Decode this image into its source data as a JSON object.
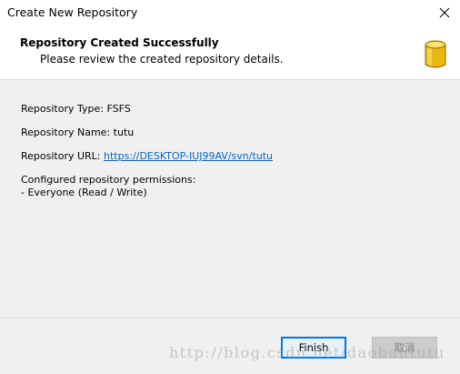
{
  "window": {
    "title": "Create New Repository"
  },
  "header": {
    "title": "Repository Created Successfully",
    "subtitle": "Please review the created repository details.",
    "icon": "database-icon"
  },
  "details": {
    "type_label": "Repository Type: ",
    "type_value": "FSFS",
    "name_label": "Repository Name: ",
    "name_value": "tutu",
    "url_label": "Repository URL: ",
    "url_value": "https://DESKTOP-IUJ99AV/svn/tutu",
    "permissions_heading": "Configured repository permissions:",
    "permissions_item": "- Everyone (Read / Write)"
  },
  "buttons": {
    "finish_label": "Finish",
    "cancel_label": "取消"
  },
  "watermark": {
    "text": "http://blog.csdn.net/daobantutu"
  },
  "colors": {
    "accent": "#0078d7",
    "link": "#0066cc",
    "icon_gold": "#f0c419"
  }
}
